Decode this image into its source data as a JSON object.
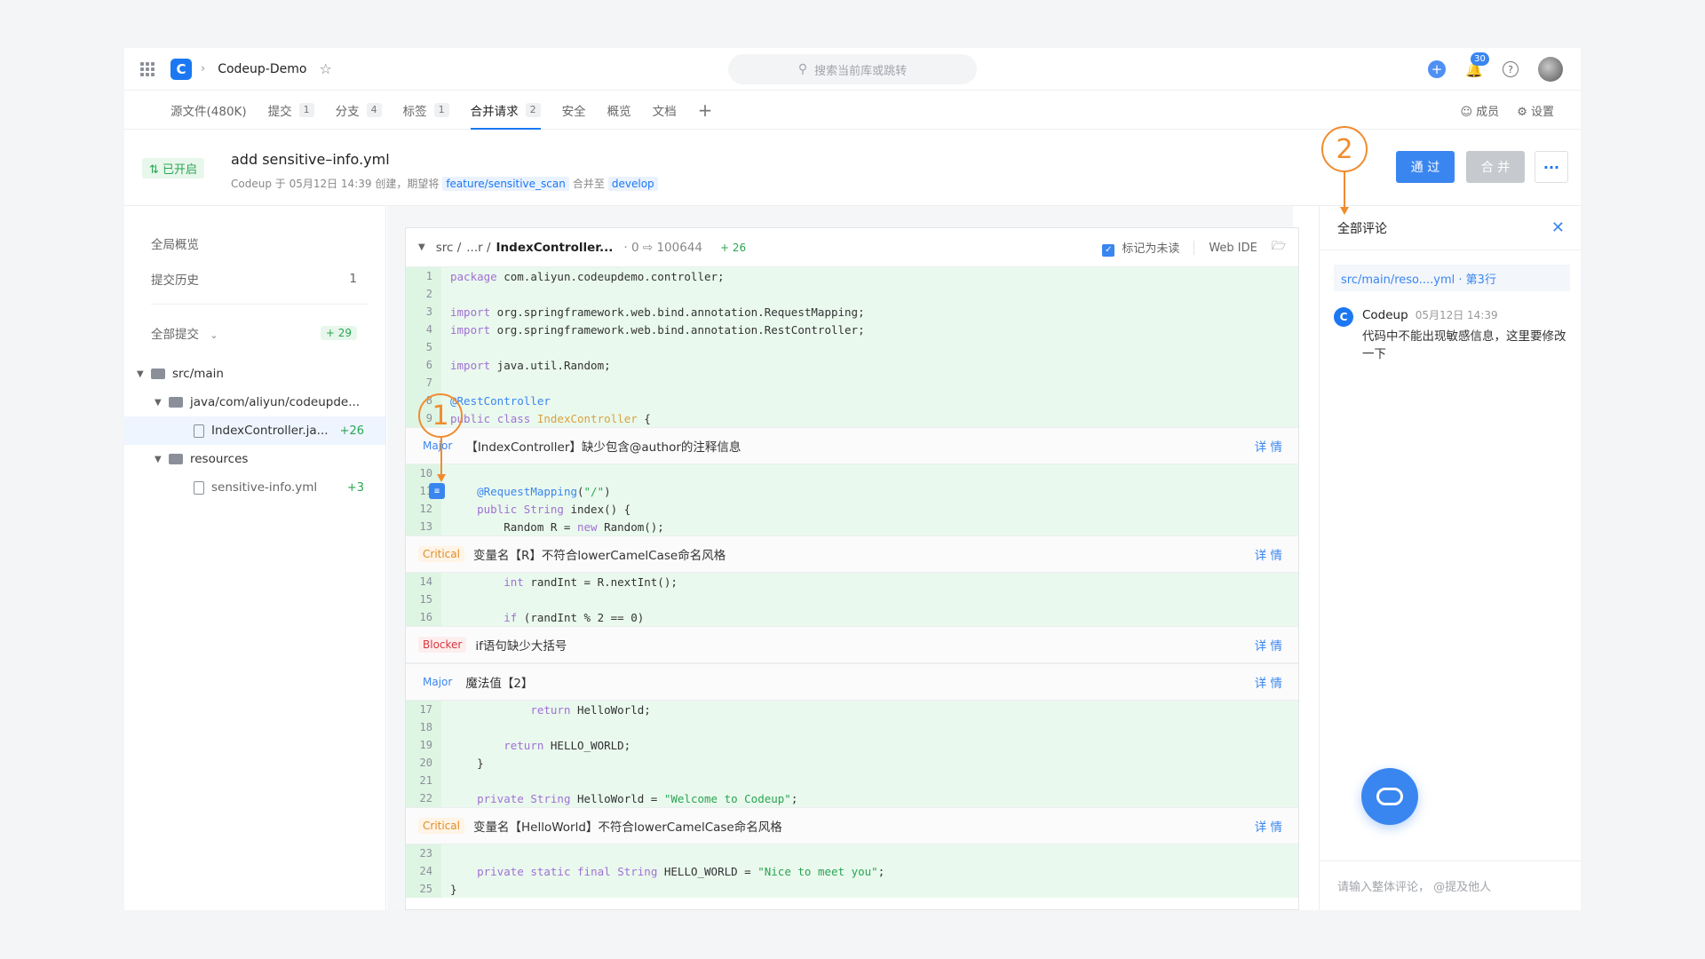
{
  "topbar": {
    "repo_name": "Codeup-Demo",
    "search_placeholder": "搜索当前库或跳转",
    "notification_count": "30",
    "logo_letter": "C"
  },
  "tabs": [
    {
      "label": "源文件(480K)",
      "count": ""
    },
    {
      "label": "提交",
      "count": "1"
    },
    {
      "label": "分支",
      "count": "4"
    },
    {
      "label": "标签",
      "count": "1"
    },
    {
      "label": "合并请求",
      "count": "2"
    },
    {
      "label": "安全",
      "count": ""
    },
    {
      "label": "概览",
      "count": ""
    },
    {
      "label": "文档",
      "count": ""
    }
  ],
  "tabs_right": {
    "members": "成员",
    "settings": "设置"
  },
  "mr": {
    "status": "已开启",
    "title": "add sensitive–info.yml",
    "sub_prefix": "Codeup 于 05月12日 14:39 创建，期望将",
    "source_branch": "feature/sensitive_scan",
    "sub_mid": "合并至",
    "target_branch": "develop",
    "approve_label": "通 过",
    "merge_label": "合 并",
    "more_label": "···"
  },
  "left": {
    "overview": "全局概览",
    "history": "提交历史",
    "history_count": "1",
    "all_commits": "全部提交",
    "all_add": "+ 29",
    "tree": [
      {
        "name": "src/main",
        "type": "folder",
        "add": ""
      },
      {
        "name": "java/com/aliyun/codeupde...",
        "type": "folder",
        "add": ""
      },
      {
        "name": "IndexController.ja...",
        "type": "file",
        "add": "+26"
      },
      {
        "name": "resources",
        "type": "folder",
        "add": ""
      },
      {
        "name": "sensitive-info.yml",
        "type": "file",
        "add": "+3"
      }
    ]
  },
  "file": {
    "path": "src /",
    "path_mid": "...r /",
    "name": "IndexController...",
    "meta": "· 0 ⇨ 100644",
    "add": "+ 26",
    "mark_unread": "标记为未读",
    "web_ide": "Web IDE"
  },
  "code_blocks": [
    {
      "lines": [
        {
          "n": "1",
          "t": "package com.aliyun.codeupdemo.controller;"
        },
        {
          "n": "2",
          "t": ""
        },
        {
          "n": "3",
          "t": "import org.springframework.web.bind.annotation.RequestMapping;"
        },
        {
          "n": "4",
          "t": "import org.springframework.web.bind.annotation.RestController;"
        },
        {
          "n": "5",
          "t": ""
        },
        {
          "n": "6",
          "t": "import java.util.Random;"
        },
        {
          "n": "7",
          "t": ""
        },
        {
          "n": "8",
          "t": "@RestController"
        },
        {
          "n": "9",
          "t": "public class IndexController {"
        }
      ]
    },
    {
      "lines": [
        {
          "n": "10",
          "t": ""
        },
        {
          "n": "11",
          "t": "    @RequestMapping(\"/\")"
        },
        {
          "n": "12",
          "t": "    public String index() {"
        },
        {
          "n": "13",
          "t": "        Random R = new Random();"
        }
      ]
    },
    {
      "lines": [
        {
          "n": "14",
          "t": "        int randInt = R.nextInt();"
        },
        {
          "n": "15",
          "t": ""
        },
        {
          "n": "16",
          "t": "        if (randInt % 2 == 0)"
        }
      ]
    },
    {
      "lines": [
        {
          "n": "17",
          "t": "            return HelloWorld;"
        },
        {
          "n": "18",
          "t": ""
        },
        {
          "n": "19",
          "t": "        return HELLO_WORLD;"
        },
        {
          "n": "20",
          "t": "    }"
        },
        {
          "n": "21",
          "t": ""
        },
        {
          "n": "22",
          "t": "    private String HelloWorld = \"Welcome to Codeup\";"
        }
      ]
    },
    {
      "lines": [
        {
          "n": "23",
          "t": ""
        },
        {
          "n": "24",
          "t": "    private static final String HELLO_WORLD = \"Nice to meet you\";"
        },
        {
          "n": "25",
          "t": "}"
        }
      ]
    }
  ],
  "issues": [
    {
      "severity": "Major",
      "text": "【IndexController】缺少包含@author的注释信息",
      "detail": "详 情"
    },
    {
      "severity": "Critical",
      "text": "变量名【R】不符合lowerCamelCase命名风格",
      "detail": "详 情"
    },
    {
      "severity": "Blocker",
      "text": "if语句缺少大括号",
      "detail": "详 情"
    },
    {
      "severity": "Major",
      "text": "魔法值【2】",
      "detail": "详 情"
    },
    {
      "severity": "Critical",
      "text": "变量名【HelloWorld】不符合lowerCamelCase命名风格",
      "detail": "详 情"
    }
  ],
  "right": {
    "title": "全部评论",
    "location": "src/main/reso....yml · 第3行",
    "comment_author": "Codeup",
    "comment_time": "05月12日 14:39",
    "comment_text": "代码中不能出现敏感信息，这里要修改一下",
    "input_placeholder": "请输入整体评论， @提及他人"
  },
  "annotations": {
    "one": "1",
    "two": "2"
  },
  "colors": {
    "accent": "#1b78f2",
    "annotation": "#f08c2e",
    "added_line": "#eaf9ee"
  }
}
